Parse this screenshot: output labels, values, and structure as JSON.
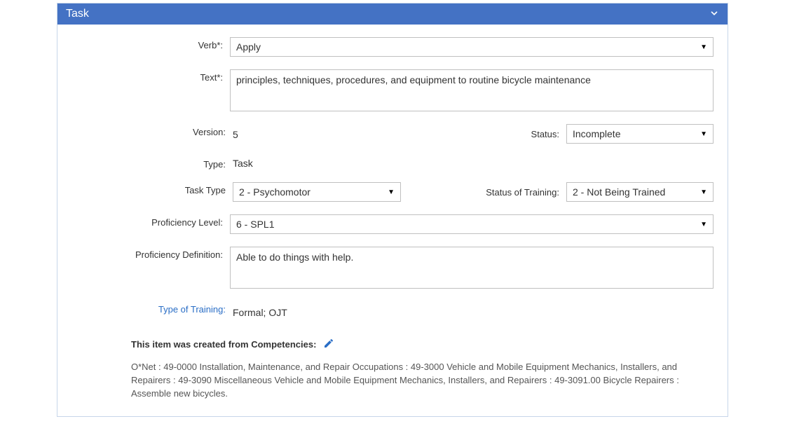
{
  "panel": {
    "title": "Task"
  },
  "labels": {
    "verb": "Verb*:",
    "text": "Text*:",
    "version": "Version:",
    "status": "Status:",
    "type": "Type:",
    "task_type": "Task Type",
    "status_of_training": "Status of Training:",
    "proficiency_level": "Proficiency Level:",
    "proficiency_definition": "Proficiency Definition:",
    "type_of_training": "Type of Training:"
  },
  "values": {
    "verb": "Apply",
    "text": "principles, techniques, procedures, and equipment to routine bicycle maintenance",
    "version": "5",
    "status": "Incomplete",
    "type": "Task",
    "task_type": "2 - Psychomotor",
    "status_of_training": "2 - Not Being Trained",
    "proficiency_level": "6 - SPL1",
    "proficiency_definition": "Able to do things with help.",
    "type_of_training": "Formal; OJT"
  },
  "competencies": {
    "heading": "This item was created from Competencies:",
    "body": "O*Net : 49-0000 Installation, Maintenance, and Repair Occupations : 49-3000 Vehicle and Mobile Equipment Mechanics, Installers, and Repairers : 49-3090 Miscellaneous Vehicle and Mobile Equipment Mechanics, Installers, and Repairers : 49-3091.00 Bicycle Repairers : Assemble new bicycles."
  }
}
